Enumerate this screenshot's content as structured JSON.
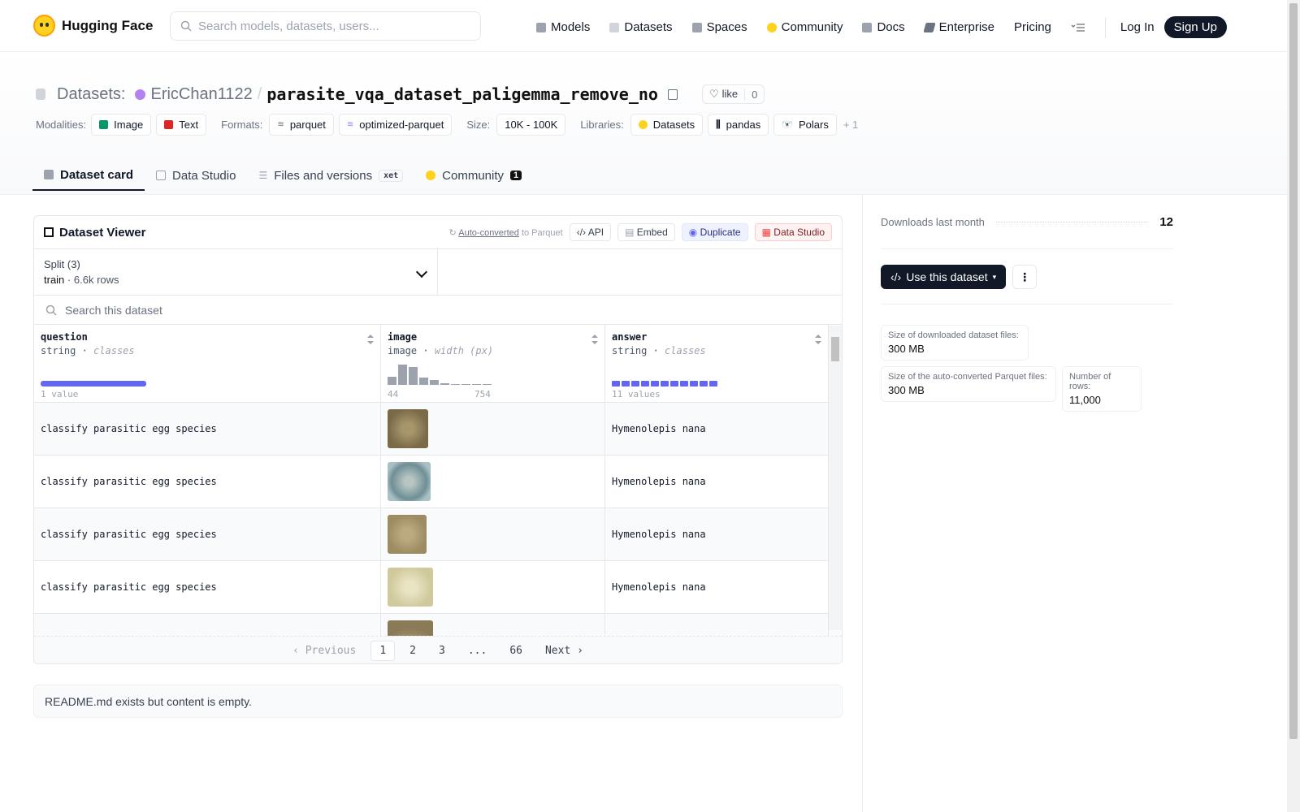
{
  "header": {
    "brand": "Hugging Face",
    "search_placeholder": "Search models, datasets, users...",
    "nav": [
      {
        "label": "Models",
        "icon": "models-icon",
        "color": "#9ca3af"
      },
      {
        "label": "Datasets",
        "icon": "datasets-icon",
        "color": "#d1d5db"
      },
      {
        "label": "Spaces",
        "icon": "spaces-icon",
        "color": "#9ca3af"
      },
      {
        "label": "Community",
        "icon": "community-icon",
        "color": "#ffd21e"
      },
      {
        "label": "Docs",
        "icon": "docs-icon",
        "color": "#9ca3af"
      },
      {
        "label": "Enterprise",
        "icon": "enterprise-icon",
        "color": "#6b7280"
      },
      {
        "label": "Pricing"
      }
    ],
    "login": "Log In",
    "signup": "Sign Up"
  },
  "repo": {
    "section": "Datasets:",
    "owner": "EricChan1122",
    "slash": "/",
    "name": "parasite_vqa_dataset_paligemma_remove_no",
    "like_label": "like",
    "like_count": "0"
  },
  "meta": {
    "modalities_label": "Modalities:",
    "modalities": [
      "Image",
      "Text"
    ],
    "formats_label": "Formats:",
    "formats": [
      "parquet",
      "optimized-parquet"
    ],
    "size_label": "Size:",
    "size": "10K - 100K",
    "libraries_label": "Libraries:",
    "libraries": [
      "Datasets",
      "pandas",
      "Polars"
    ],
    "more": "+ 1"
  },
  "tabs": [
    {
      "label": "Dataset card"
    },
    {
      "label": "Data Studio"
    },
    {
      "label": "Files and versions",
      "tag": "xet"
    },
    {
      "label": "Community",
      "badge": "1"
    }
  ],
  "viewer": {
    "title": "Dataset Viewer",
    "autoconv": "Auto-converted",
    "autoconv_suffix": "to Parquet",
    "api": "API",
    "embed": "Embed",
    "duplicate": "Duplicate",
    "data_studio": "Data Studio",
    "split_label": "Split (3)",
    "split_value": "train",
    "split_sep": "·",
    "split_rows": "6.6k rows",
    "search_placeholder": "Search this dataset",
    "columns": [
      {
        "name": "question",
        "type": "string",
        "sub": "classes",
        "foot": "1 value"
      },
      {
        "name": "image",
        "type": "image",
        "sub": "width (px)",
        "min": "44",
        "max": "754",
        "hist": [
          0.4,
          0.95,
          0.85,
          0.35,
          0.22,
          0.08,
          0.05,
          0.05,
          0.05,
          0.05
        ]
      },
      {
        "name": "answer",
        "type": "string",
        "sub": "classes",
        "foot": "11 values"
      }
    ],
    "rows": [
      {
        "question": "classify parasitic egg species",
        "answer": "Hymenolepis nana",
        "thumb": "#8a7a58"
      },
      {
        "question": "classify parasitic egg species",
        "answer": "Hymenolepis nana",
        "thumb": "#7e9fa3"
      },
      {
        "question": "classify parasitic egg species",
        "answer": "Hymenolepis nana",
        "thumb": "#a89872"
      },
      {
        "question": "classify parasitic egg species",
        "answer": "Hymenolepis nana",
        "thumb": "#d3cfa3"
      }
    ],
    "pager": {
      "prev": "Previous",
      "pages": [
        "1",
        "2",
        "3",
        "...",
        "66"
      ],
      "next": "Next"
    }
  },
  "readme": "README.md exists but content is empty.",
  "sidebar": {
    "downloads_label": "Downloads last month",
    "downloads": "12",
    "use_button": "Use this dataset",
    "stats": [
      {
        "k": "Size of downloaded dataset files:",
        "v": "300 MB"
      },
      {
        "k": "Size of the auto-converted Parquet files:",
        "v": "300 MB"
      },
      {
        "k": "Number of rows:",
        "v": "11,000"
      }
    ]
  }
}
